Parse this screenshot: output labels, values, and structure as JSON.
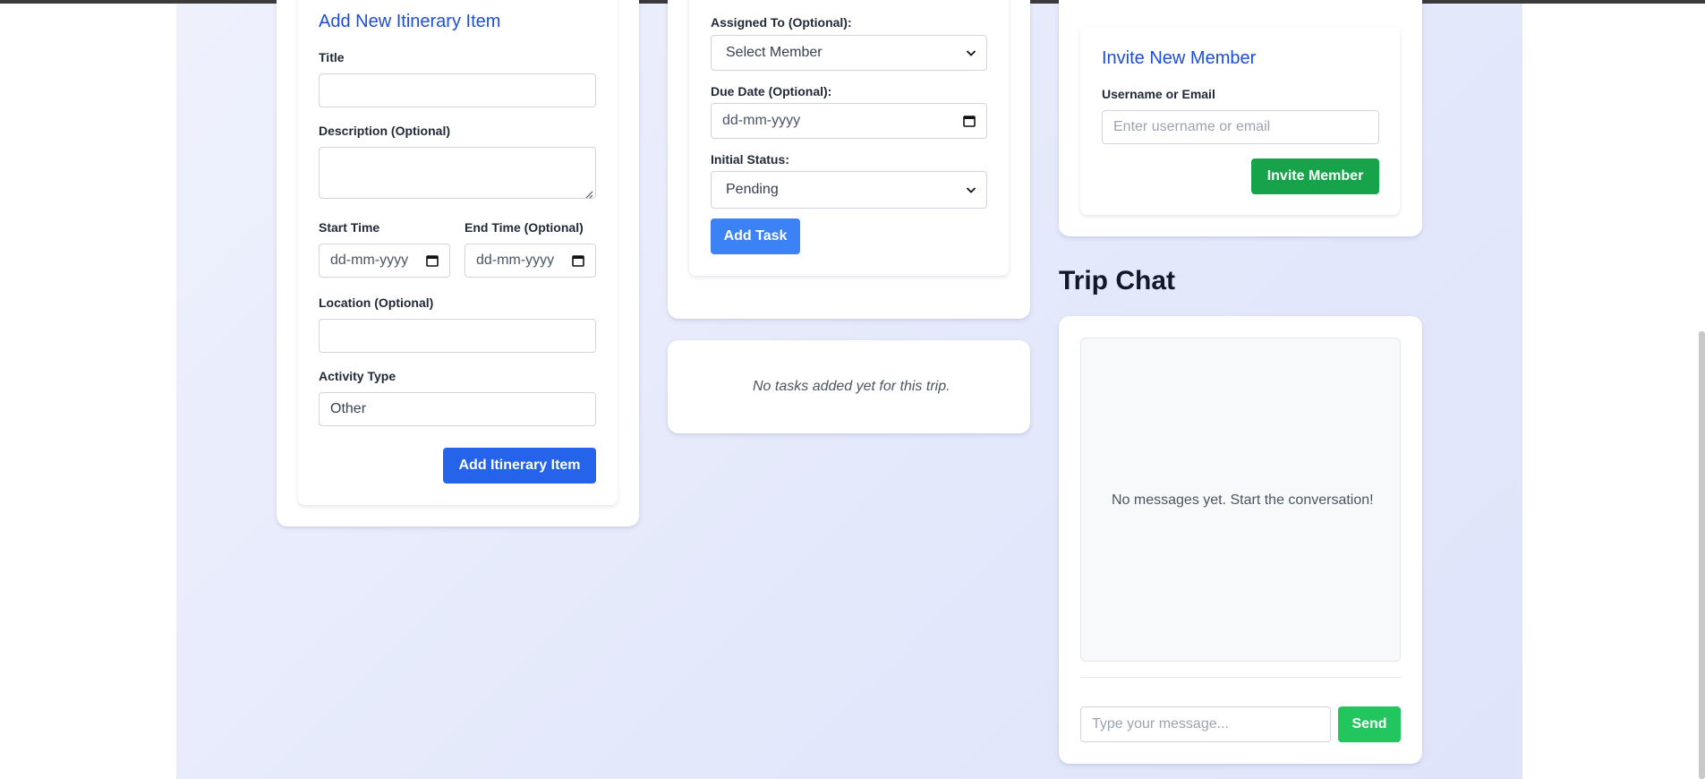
{
  "itinerary_form": {
    "title": "Add New Itinerary Item",
    "title_label": "Title",
    "title_value": "",
    "description_label": "Description (Optional)",
    "start_time_label": "Start Time",
    "start_time_value": "dd-mm-yyyy",
    "end_time_label": "End Time (Optional)",
    "end_time_value": "dd-mm-yyyy",
    "location_label": "Location (Optional)",
    "activity_type_label": "Activity Type",
    "activity_type_value": "Other",
    "submit_label": "Add Itinerary Item"
  },
  "task_form": {
    "assigned_label": "Assigned To (Optional):",
    "assigned_value": "Select Member",
    "due_date_label": "Due Date (Optional):",
    "due_date_value": "dd-mm-yyyy",
    "status_label": "Initial Status:",
    "status_value": "Pending",
    "submit_label": "Add Task"
  },
  "task_list": {
    "empty_text": "No tasks added yet for this trip."
  },
  "invite_form": {
    "title": "Invite New Member",
    "username_label": "Username or Email",
    "username_placeholder": "Enter username or email",
    "submit_label": "Invite Member"
  },
  "chat": {
    "heading": "Trip Chat",
    "empty_text": "No messages yet. Start the conversation!",
    "input_placeholder": "Type your message...",
    "send_label": "Send"
  },
  "colors": {
    "accent_blue": "#2563eb",
    "accent_green": "#16a34a",
    "title_blue": "#1d4ed8"
  },
  "icons": [
    "calendar-icon",
    "chevron-down-icon",
    "resize-handle-icon"
  ]
}
